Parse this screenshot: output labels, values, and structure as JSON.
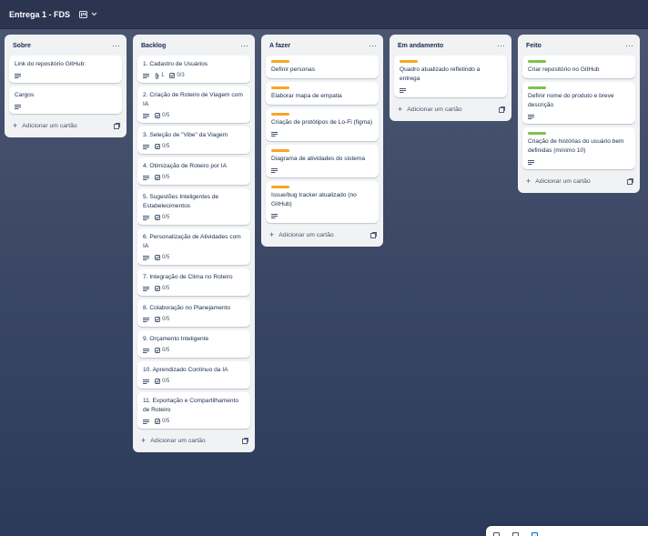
{
  "board": {
    "title": "Entrega 1 - FDS",
    "view_icon": "board-view-icon"
  },
  "colors": {
    "label_orange": "#f5a623",
    "label_green": "#7ec24a"
  },
  "lists": [
    {
      "title": "Sobre",
      "cards": [
        {
          "title": "Link do repositório GitHub:",
          "description": true
        },
        {
          "title": "Cargos",
          "description": true
        }
      ],
      "add_label": "Adicionar um cartão"
    },
    {
      "title": "Backlog",
      "cards": [
        {
          "title": "1. Cadastro de Usuários",
          "description": true,
          "attachments": "1",
          "checklist": "0/3"
        },
        {
          "title": "2. Criação de Roteiro de Viagem com IA",
          "description": true,
          "checklist": "0/5"
        },
        {
          "title": "3. Seleção de \"Vibe\" da Viagem",
          "description": true,
          "checklist": "0/5"
        },
        {
          "title": "4. Otimização de Roteiro por IA",
          "description": true,
          "checklist": "0/5"
        },
        {
          "title": "5. Sugestões Inteligentes de Estabelecimentos",
          "description": true,
          "checklist": "0/5"
        },
        {
          "title": "6. Personalização de Atividades com IA",
          "description": true,
          "checklist": "0/5"
        },
        {
          "title": "7. Integração de Clima no Roteiro",
          "description": true,
          "checklist": "0/5"
        },
        {
          "title": "8. Colaboração no Planejamento",
          "description": true,
          "checklist": "0/5"
        },
        {
          "title": "9. Orçamento Inteligente",
          "description": true,
          "checklist": "0/5"
        },
        {
          "title": "10. Aprendizado Contínuo da IA",
          "description": true,
          "checklist": "0/5"
        },
        {
          "title": "11. Exportação e Compartilhamento de Roteiro",
          "description": true,
          "checklist": "0/5"
        }
      ],
      "add_label": "Adicionar um cartão"
    },
    {
      "title": "A fazer",
      "cards": [
        {
          "title": "Definir personas",
          "label": "orange"
        },
        {
          "title": "Elaborar mapa de empatia",
          "label": "orange"
        },
        {
          "title": "Criação de protótipos de Lo-Fi (figma)",
          "label": "orange",
          "description": true
        },
        {
          "title": "Diagrama de atividades do sistema",
          "label": "orange",
          "description": true
        },
        {
          "title": "Issue/bug tracker atualizado (no GitHub)",
          "label": "orange",
          "description": true
        }
      ],
      "add_label": "Adicionar um cartão"
    },
    {
      "title": "Em andamento",
      "cards": [
        {
          "title": "Quadro atualizado refletindo a entrega",
          "label": "orange",
          "description": true
        }
      ],
      "add_label": "Adicionar um cartão"
    },
    {
      "title": "Feito",
      "cards": [
        {
          "title": "Criar repositório no GitHub",
          "label": "green"
        },
        {
          "title": "Definir nome do produto e breve descrição",
          "label": "green",
          "description": true
        },
        {
          "title": "Criação de histórias do usuário bem definidas (mínimo 10)",
          "label": "green",
          "description": true
        }
      ],
      "add_label": "Adicionar um cartão"
    }
  ]
}
